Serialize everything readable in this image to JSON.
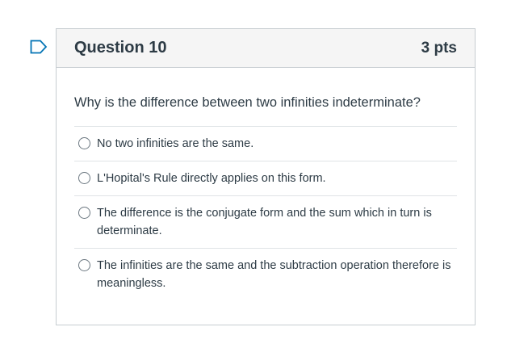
{
  "question": {
    "title": "Question 10",
    "points": "3 pts",
    "text": "Why is the difference between two infinities indeterminate?",
    "answers": [
      {
        "label": "No two infinities are the same."
      },
      {
        "label": "L'Hopital's Rule directly applies on this form."
      },
      {
        "label": "The difference is the conjugate form and the sum which in turn is determinate."
      },
      {
        "label": "The infinities are the same and the subtraction operation therefore is meaningless."
      }
    ]
  },
  "icons": {
    "flag": "bookmark-flag-icon"
  },
  "colors": {
    "text": "#2d3b45",
    "header_bg": "#f5f5f5",
    "border": "#c7cdd1",
    "flag": "#0374b5"
  }
}
